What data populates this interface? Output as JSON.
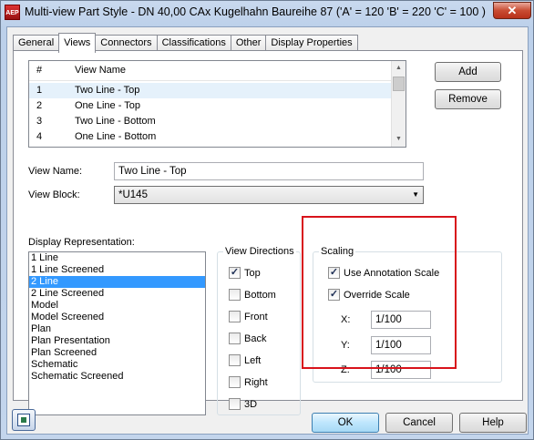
{
  "window": {
    "title": "Multi-view Part Style - DN 40,00 CAx Kugelhahn Baureihe 87 ('A' = 120 'B' = 220 'C' = 100 )",
    "app_icon_text": "AEP",
    "close_symbol": "✕"
  },
  "tabs": [
    "General",
    "Views",
    "Connectors",
    "Classifications",
    "Other",
    "Display Properties"
  ],
  "views_list": {
    "col_num": "#",
    "col_name": "View Name",
    "rows": [
      {
        "num": "1",
        "name": "Two Line - Top"
      },
      {
        "num": "2",
        "name": "One Line - Top"
      },
      {
        "num": "3",
        "name": "Two Line - Bottom"
      },
      {
        "num": "4",
        "name": "One Line - Bottom"
      }
    ]
  },
  "buttons": {
    "add": "Add",
    "remove": "Remove",
    "ok": "OK",
    "cancel": "Cancel",
    "help": "Help"
  },
  "view_name": {
    "label": "View Name:",
    "value": "Two Line - Top"
  },
  "view_block": {
    "label": "View Block:",
    "value": "*U145"
  },
  "display_rep": {
    "label": "Display Representation:",
    "items": [
      "1 Line",
      "1 Line Screened",
      "2 Line",
      "2 Line Screened",
      "Model",
      "Model Screened",
      "Plan",
      "Plan Presentation",
      "Plan Screened",
      "Schematic",
      "Schematic Screened"
    ],
    "selected_index": 2
  },
  "view_directions": {
    "title": "View Directions",
    "items": [
      {
        "label": "Top",
        "checked": true
      },
      {
        "label": "Bottom",
        "checked": false
      },
      {
        "label": "Front",
        "checked": false
      },
      {
        "label": "Back",
        "checked": false
      },
      {
        "label": "Left",
        "checked": false
      },
      {
        "label": "Right",
        "checked": false
      },
      {
        "label": "3D",
        "checked": false
      }
    ]
  },
  "scaling": {
    "title": "Scaling",
    "use_annotation_scale": "Use Annotation Scale",
    "override_scale": "Override Scale",
    "x_label": "X:",
    "x_value": "1/100",
    "y_label": "Y:",
    "y_value": "1/100",
    "z_label": "Z:",
    "z_value": "1/100"
  },
  "colors": {
    "highlight_box": "#d8131b",
    "selection": "#3399ff"
  }
}
